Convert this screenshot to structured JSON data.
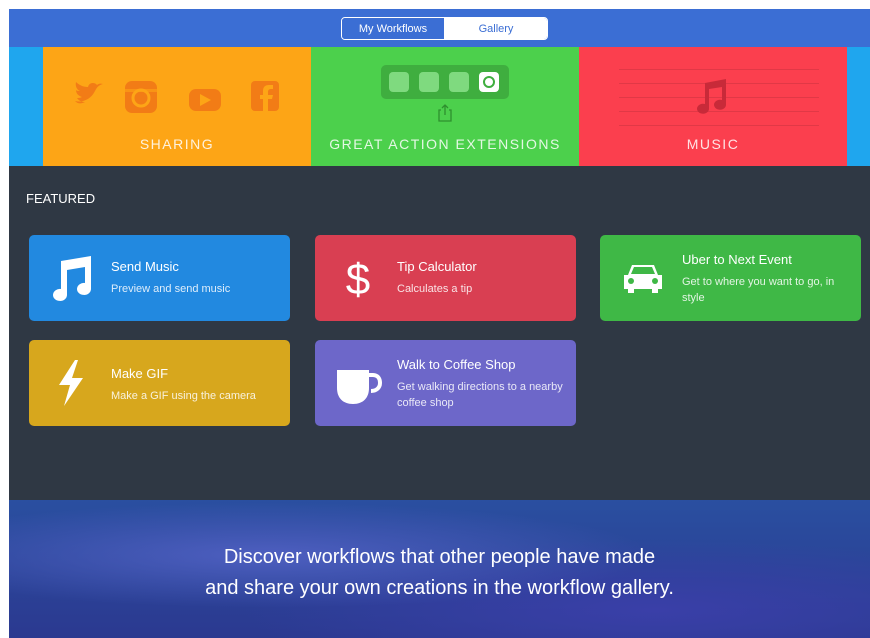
{
  "tabs": {
    "my_workflows": "My Workflows",
    "gallery": "Gallery"
  },
  "banners": {
    "sharing": "SHARING",
    "actions": "GREAT ACTION EXTENSIONS",
    "music": "MUSIC"
  },
  "featured": {
    "heading": "FEATURED",
    "cards": [
      {
        "title": "Send Music",
        "subtitle": "Preview and send music",
        "color": "#2289e0",
        "icon": "music-note-icon"
      },
      {
        "title": "Tip Calculator",
        "subtitle": "Calculates a tip",
        "color": "#d93f52",
        "icon": "dollar-icon"
      },
      {
        "title": "Uber to Next Event",
        "subtitle": "Get to where you want to go, in style",
        "color": "#3fb846",
        "icon": "car-icon"
      },
      {
        "title": "Make GIF",
        "subtitle": "Make a GIF using the camera",
        "color": "#d7a71d",
        "icon": "lightning-icon"
      },
      {
        "title": "Walk to Coffee Shop",
        "subtitle": "Get walking directions to a nearby coffee shop",
        "color": "#6d67c9",
        "icon": "coffee-cup-icon"
      }
    ]
  },
  "promo": {
    "line1": "Discover workflows that other people have made",
    "line2": "and share your own creations in the workflow gallery."
  }
}
